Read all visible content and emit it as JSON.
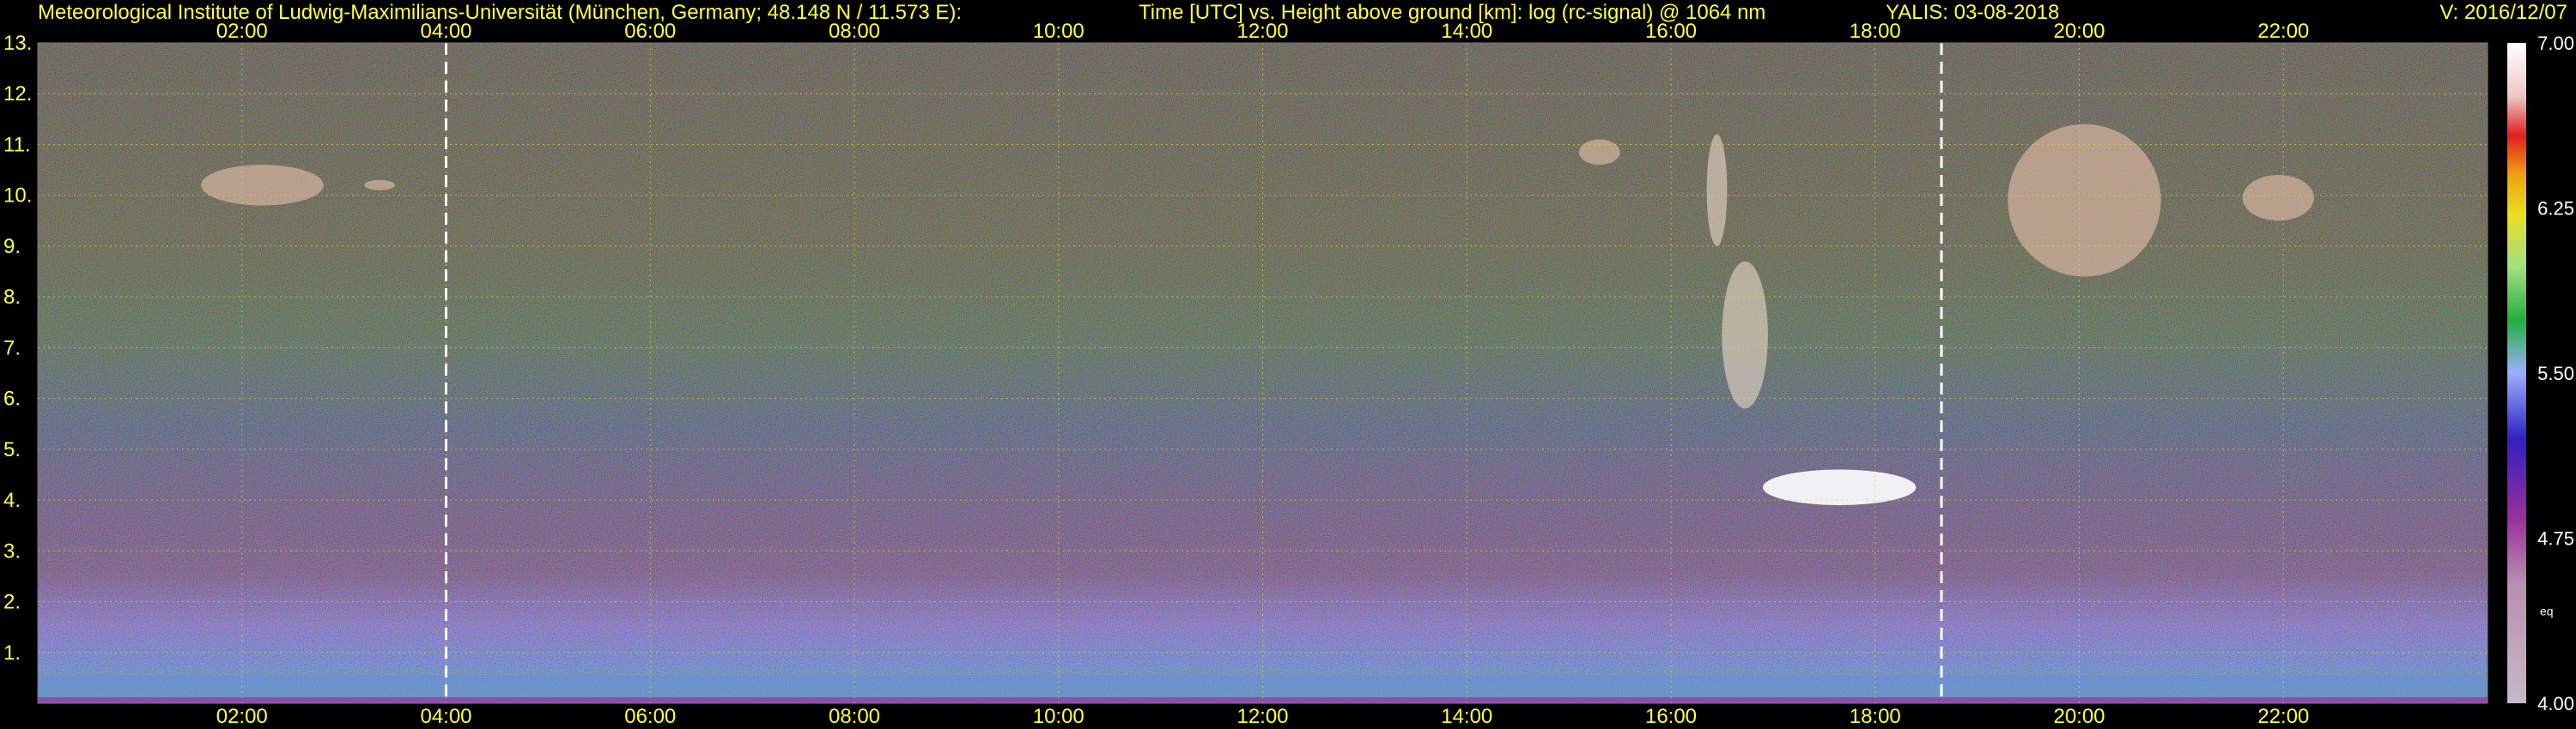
{
  "header": {
    "institute": "Meteorological Institute of Ludwig-Maximilians-Universität (München, Germany; 48.148 N / 11.573 E):",
    "axes_title": "Time [UTC] vs. Height above ground [km]: log (rc-signal) @ 1064 nm",
    "station_date": "YALIS: 03-08-2018",
    "version": "V: 2016/12/07"
  },
  "colors": {
    "text": "#ffff44",
    "grid": "#d8d840",
    "marker": "#ffffff",
    "background": "#000000"
  },
  "chart_data": {
    "type": "heatmap",
    "variable": "log (rc-signal) @ 1064 nm",
    "x_axis": {
      "label": "Time [UTC]",
      "range_hours": [
        0.0,
        24.0
      ],
      "tick_hours": [
        2,
        4,
        6,
        8,
        10,
        12,
        14,
        16,
        18,
        20,
        22
      ],
      "tick_labels": [
        "02:00",
        "04:00",
        "06:00",
        "08:00",
        "10:00",
        "12:00",
        "14:00",
        "16:00",
        "18:00",
        "20:00",
        "22:00"
      ]
    },
    "y_axis": {
      "label": "Height above ground [km]",
      "range_km": [
        0,
        13
      ],
      "tick_values": [
        1,
        2,
        3,
        4,
        5,
        6,
        7,
        8,
        9,
        10,
        11,
        12,
        13
      ],
      "tick_labels": [
        "1.",
        "2.",
        "3.",
        "4.",
        "5.",
        "6.",
        "7.",
        "8.",
        "9.",
        "10.",
        "11.",
        "12.",
        "13."
      ]
    },
    "colorbar": {
      "range": [
        4.0,
        7.0
      ],
      "tick_values": [
        4.0,
        4.75,
        5.5,
        6.25,
        7.0
      ],
      "tick_labels": [
        "4.00",
        "4.75",
        "5.50",
        "6.25",
        "7.00"
      ],
      "unit_label": "eq"
    },
    "time_markers_hours": [
      4.0,
      18.65
    ],
    "grid": true,
    "features": [
      {
        "kind": "cirrus",
        "t0": 1.6,
        "t1": 2.8,
        "h0": 9.8,
        "h1": 10.6
      },
      {
        "kind": "cirrus",
        "t0": 3.2,
        "t1": 3.5,
        "h0": 10.1,
        "h1": 10.3
      },
      {
        "kind": "cirrus",
        "t0": 15.1,
        "t1": 15.5,
        "h0": 10.6,
        "h1": 11.1
      },
      {
        "kind": "fallstreak",
        "t0": 16.35,
        "t1": 16.55,
        "h0": 9.0,
        "h1": 11.2
      },
      {
        "kind": "fallstreak",
        "t0": 16.5,
        "t1": 16.95,
        "h0": 5.8,
        "h1": 8.7
      },
      {
        "kind": "water_cloud",
        "t0": 16.9,
        "t1": 18.4,
        "h0": 3.9,
        "h1": 4.6
      },
      {
        "kind": "cirrus",
        "t0": 19.3,
        "t1": 20.8,
        "h0": 8.4,
        "h1": 11.4
      },
      {
        "kind": "cirrus",
        "t0": 21.6,
        "t1": 22.3,
        "h0": 9.5,
        "h1": 10.4
      }
    ]
  }
}
